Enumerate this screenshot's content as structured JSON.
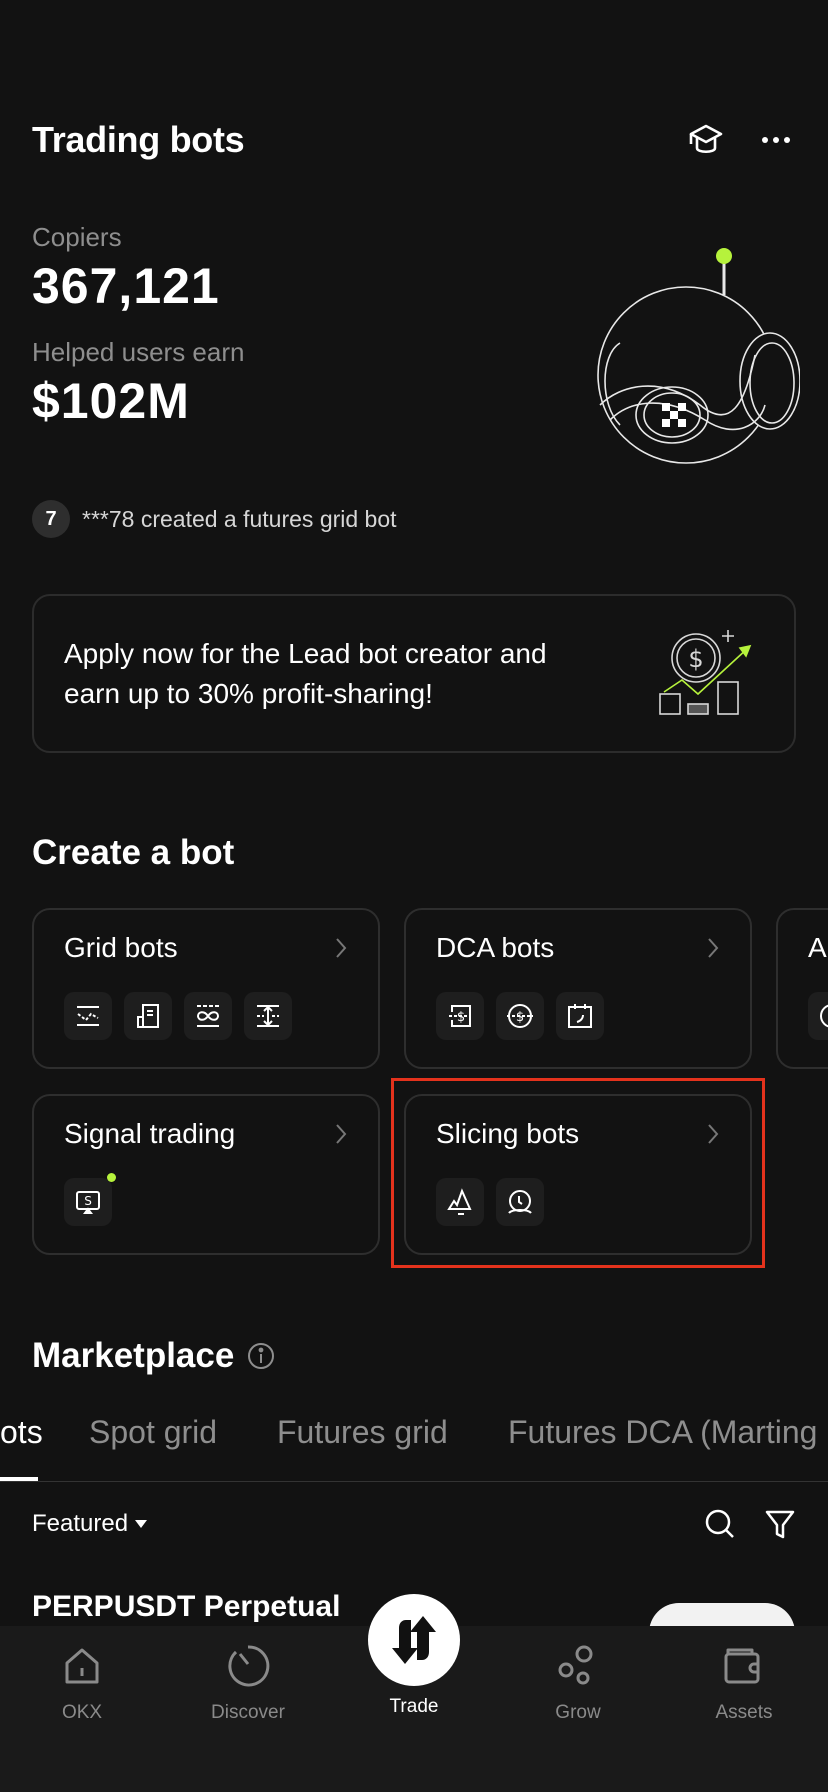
{
  "header": {
    "title": "Trading bots",
    "icons": [
      "graduation-cap-icon",
      "more-icon"
    ]
  },
  "stats": {
    "copiers_label": "Copiers",
    "copiers_value": "367,121",
    "earn_label": "Helped users earn",
    "earn_value": "$102M"
  },
  "activity": {
    "badge": "7",
    "text": "***78 created a futures grid bot"
  },
  "promo": {
    "text": "Apply now for the Lead bot creator and earn up to 30% profit-sharing!"
  },
  "create": {
    "title": "Create a bot",
    "cards": [
      {
        "title": "Grid bots",
        "icons": [
          "grid-line-icon",
          "document-icon",
          "infinity-grid-icon",
          "range-grid-icon"
        ]
      },
      {
        "title": "DCA bots",
        "icons": [
          "dca-wallet-icon",
          "dca-coin-icon",
          "calendar-icon"
        ]
      },
      {
        "title": "A",
        "icons": [
          "clock-icon"
        ]
      },
      {
        "title": "Signal trading",
        "icons": [
          "signal-screen-icon"
        ]
      },
      {
        "title": "Slicing bots",
        "icons": [
          "iceberg-icon",
          "twap-clock-icon"
        ]
      }
    ]
  },
  "marketplace": {
    "title": "Marketplace",
    "tabs": [
      "ots",
      "Spot grid",
      "Futures grid",
      "Futures DCA (Marting"
    ],
    "active_tab": 0,
    "sort_label": "Featured",
    "list_item_title": "PERPUSDT Perpetual"
  },
  "nav": {
    "items": [
      "OKX",
      "Discover",
      "Trade",
      "Grow",
      "Assets"
    ],
    "active": "Trade"
  },
  "colors": {
    "accent": "#b6f23c",
    "highlight": "#e4321c",
    "background": "#121212"
  }
}
